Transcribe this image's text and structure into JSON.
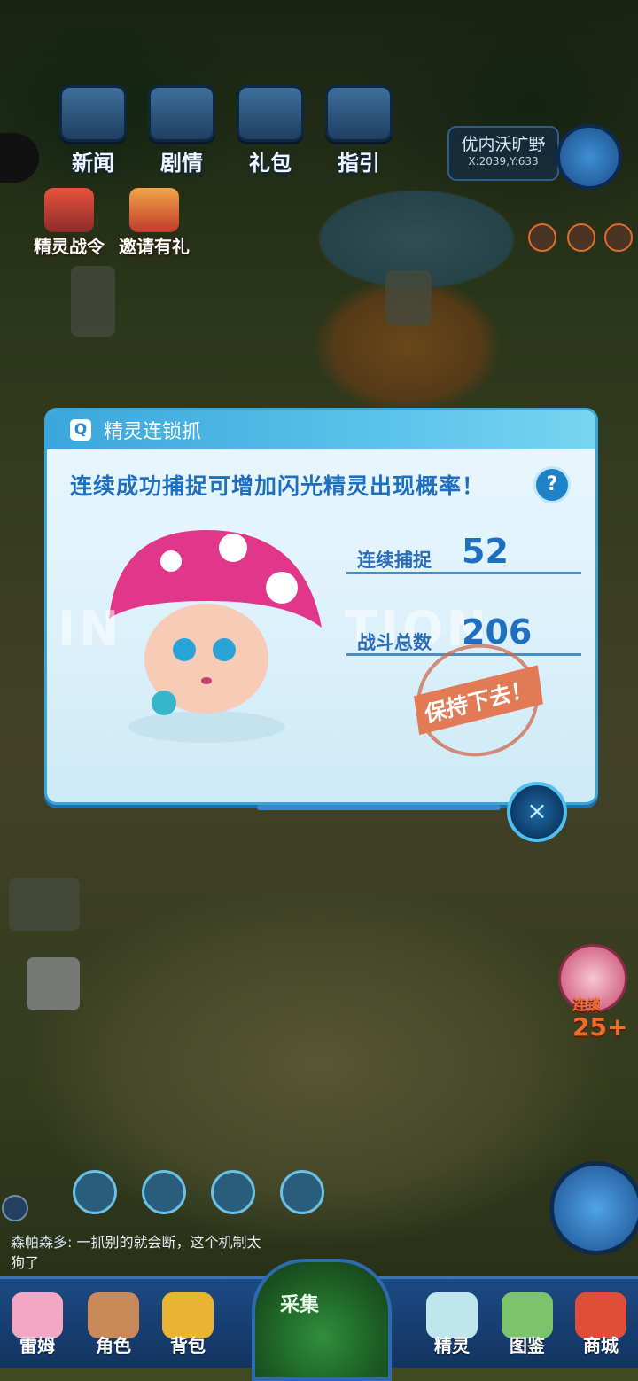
{
  "top_menu": [
    {
      "label": "新闻",
      "icon": "newspaper-board-icon"
    },
    {
      "label": "剧情",
      "icon": "story-monitor-icon"
    },
    {
      "label": "礼包",
      "icon": "gift-chest-icon"
    },
    {
      "label": "指引",
      "icon": "guide-monitor-icon"
    }
  ],
  "map": {
    "name": "优内沃旷野",
    "coords": "X:2039,Y:633"
  },
  "events": [
    {
      "label": "精灵战令",
      "icon": "battle-pass-icon"
    },
    {
      "label": "邀请有礼",
      "icon": "invite-gift-icon"
    }
  ],
  "popup": {
    "title": "精灵连锁抓",
    "tagline": "连续成功捕捉可增加闪光精灵出现概率！",
    "help": "?",
    "stats": [
      {
        "label": "连续捕捉",
        "value": "52"
      },
      {
        "label": "战斗总数",
        "value": "206"
      }
    ],
    "stamp_text": "保持下去！",
    "close": "×"
  },
  "combo_badge": {
    "label": "连锁",
    "count": "25+"
  },
  "chat": {
    "speaker": "森帕森多:",
    "message": " 一抓别的就会断，这个机制太狗了"
  },
  "bottom_nav": [
    {
      "label": "雷姆",
      "icon": "pet-leimu-icon"
    },
    {
      "label": "角色",
      "icon": "character-icon"
    },
    {
      "label": "背包",
      "icon": "backpack-icon"
    },
    {
      "label": "精灵",
      "icon": "spirit-icon"
    },
    {
      "label": "图鉴",
      "icon": "book-icon"
    },
    {
      "label": "商城",
      "icon": "shop-icon"
    }
  ],
  "center_action": {
    "label": "采集",
    "icon": "collect-rock-icon"
  }
}
